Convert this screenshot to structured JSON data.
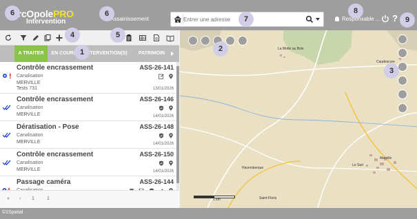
{
  "app": {
    "logo_main": "arcOpole",
    "logo_pro": "PRO",
    "logo_sub": "Intervention",
    "module_title": "Assainissement",
    "user_label": "Responsable ...",
    "help_glyph": "?"
  },
  "search": {
    "placeholder": "Entrer une adresse"
  },
  "tabs": [
    {
      "label": "A TRAITER",
      "active": true
    },
    {
      "label": "EN COURS",
      "active": false
    },
    {
      "label": "INTERVENTION(S)",
      "active": false
    },
    {
      "label": "PATRIMOIN",
      "active": false
    }
  ],
  "items": [
    {
      "title": "Contrôle encrassement",
      "code": "ASS-26-141",
      "type": "Canalisation",
      "commune": "MERVILLE",
      "extra": "Tests 731",
      "date": "13/01/2026",
      "state": "urgent"
    },
    {
      "title": "Contrôle encrassement",
      "code": "ASS-26-146",
      "type": "Canalisation",
      "commune": "MERVILLE",
      "extra": "",
      "date": "14/01/2026",
      "state": "done"
    },
    {
      "title": "Dératisation - Pose",
      "code": "ASS-26-148",
      "type": "Canalisation",
      "commune": "MERVILLE",
      "extra": "",
      "date": "14/01/2026",
      "state": "done"
    },
    {
      "title": "Contrôle encrassement",
      "code": "ASS-26-150",
      "type": "Canalisation",
      "commune": "MERVILLE",
      "extra": "",
      "date": "14/01/2026",
      "state": "done"
    },
    {
      "title": "Passage caméra",
      "code": "ASS-26-144",
      "type": "Canalisation",
      "commune": "",
      "extra": "",
      "date": "",
      "state": "warning"
    }
  ],
  "pager": {
    "prev_first": "«",
    "prev": "‹",
    "current": "1",
    "total": "1"
  },
  "map": {
    "towns": [
      "La Motte au Bois",
      "Caudescure",
      "Haverskerque",
      "Saint-Floris",
      "Merville",
      "Le Sart"
    ],
    "scale_label": "1 km"
  },
  "callouts": [
    "6",
    "6",
    "7",
    "8",
    "9",
    "1",
    "4",
    "5",
    "2",
    "3"
  ],
  "footer": {
    "copyright": "©1Spatial"
  },
  "colors": {
    "accent_green": "#8bc34a",
    "logo_yellow": "#f5e227",
    "topbar_gray": "#9e9e9e",
    "blue_check": "#1e4bd2",
    "urgent_red": "#e53935"
  },
  "icons": {
    "toolbar": [
      "refresh-icon",
      "filter-icon",
      "pencil-icon",
      "copy-icon",
      "plus-icon",
      "clipboard-icon",
      "table-icon",
      "document-icon",
      "book-icon"
    ],
    "map_left": [
      "eye-icon",
      "plus-icon",
      "globe-icon",
      "arrow-left-icon",
      "minus-icon"
    ],
    "map_right": [
      "download-icon",
      "layers-icon",
      "camera-icon",
      "edit-icon",
      "list-icon",
      "contrast-icon"
    ]
  }
}
